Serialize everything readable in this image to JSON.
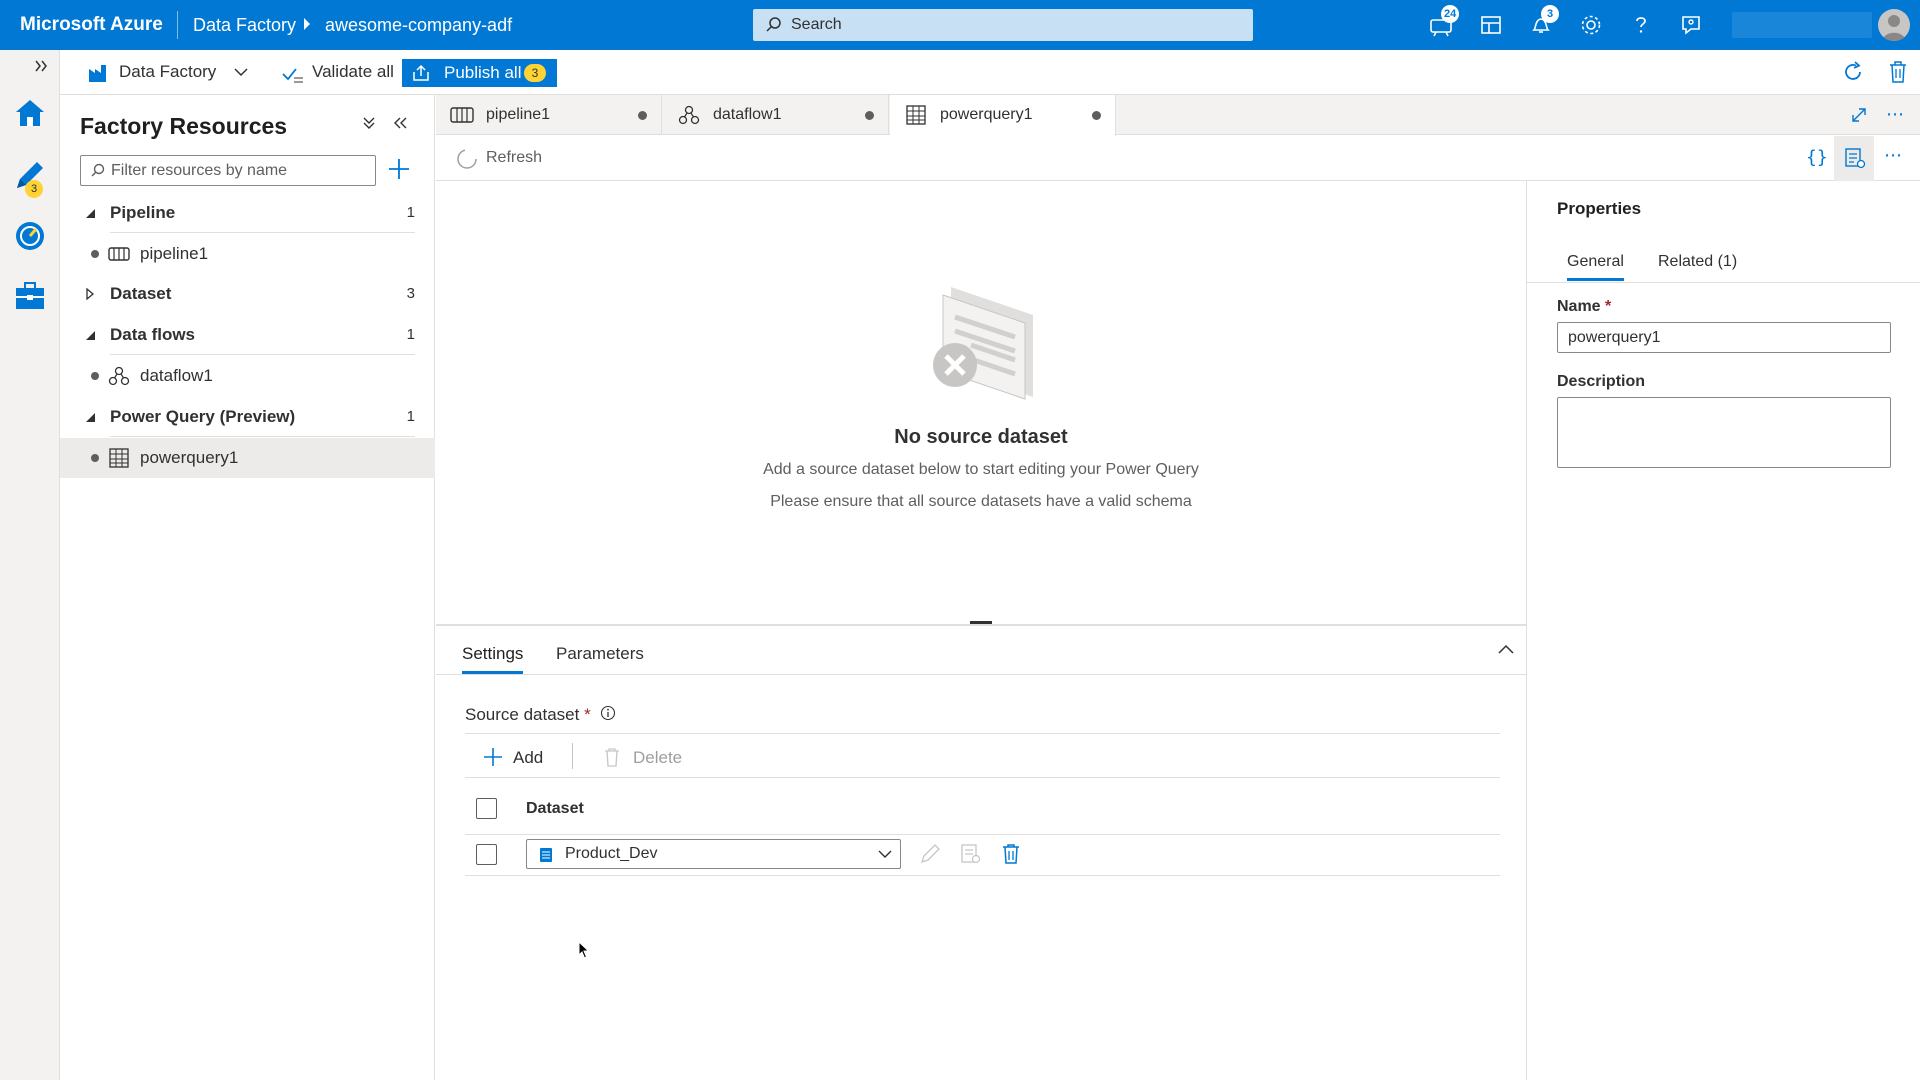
{
  "topbar": {
    "brand": "Microsoft Azure",
    "breadcrumb": [
      "Data Factory",
      "awesome-company-adf"
    ],
    "search_placeholder": "Search",
    "cloud_shell_badge": "24",
    "notifications_badge": "3",
    "colors": {
      "bar": "#0078d4",
      "search": "#c7e0f4"
    }
  },
  "rail": {
    "items": [
      {
        "name": "home-icon",
        "badge": ""
      },
      {
        "name": "author-pencil-icon",
        "badge": "3"
      },
      {
        "name": "monitor-icon",
        "badge": ""
      },
      {
        "name": "manage-toolbox-icon",
        "badge": ""
      }
    ]
  },
  "toolbar": {
    "factory_label": "Data Factory",
    "validate_label": "Validate all",
    "publish_label": "Publish all",
    "publish_count": "3"
  },
  "resources": {
    "title": "Factory Resources",
    "filter_placeholder": "Filter resources by name",
    "groups": [
      {
        "label": "Pipeline",
        "count": "1",
        "expanded": true,
        "items": [
          "pipeline1"
        ]
      },
      {
        "label": "Dataset",
        "count": "3",
        "expanded": false,
        "items": []
      },
      {
        "label": "Data flows",
        "count": "1",
        "expanded": true,
        "items": [
          "dataflow1"
        ]
      },
      {
        "label": "Power Query (Preview)",
        "count": "1",
        "expanded": true,
        "items": [
          "powerquery1"
        ]
      }
    ]
  },
  "tabs": [
    {
      "label": "pipeline1",
      "icon": "pipeline-icon",
      "active": false
    },
    {
      "label": "dataflow1",
      "icon": "dataflow-icon",
      "active": false
    },
    {
      "label": "powerquery1",
      "icon": "powerquery-icon",
      "active": true
    }
  ],
  "subbar": {
    "refresh_label": "Refresh"
  },
  "canvas": {
    "empty_title": "No source dataset",
    "empty_line1": "Add a source dataset below to start editing your Power Query",
    "empty_line2": "Please ensure that all source datasets have a valid schema"
  },
  "settings": {
    "tabs": [
      "Settings",
      "Parameters"
    ],
    "source_label": "Source dataset",
    "required_mark": "*",
    "add_label": "Add",
    "delete_label": "Delete",
    "column_header": "Dataset",
    "rows": [
      {
        "dataset": "Product_Dev"
      }
    ]
  },
  "properties": {
    "title": "Properties",
    "tabs": [
      "General",
      "Related (1)"
    ],
    "name_label": "Name",
    "required_mark": "*",
    "name_value": "powerquery1",
    "description_label": "Description",
    "description_value": ""
  }
}
